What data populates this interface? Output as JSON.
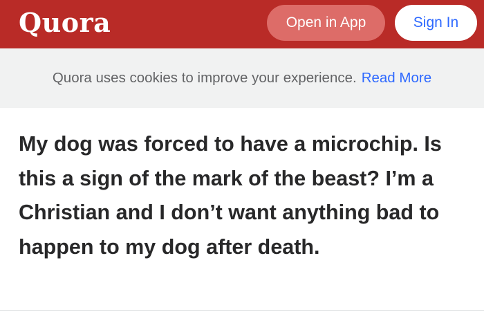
{
  "header": {
    "logo": "Quora",
    "open_in_app_label": "Open in App",
    "sign_in_label": "Sign In",
    "brand_color": "#b92b27",
    "link_color": "#2e69ff"
  },
  "cookie_notice": {
    "text": "Quora uses cookies to improve your experience.",
    "read_more_label": "Read More"
  },
  "question": {
    "title": "My dog was forced to have a microchip. Is this a sign of the mark of the beast? I’m a Christian and I don’t want anything bad to happen to my dog after death."
  }
}
